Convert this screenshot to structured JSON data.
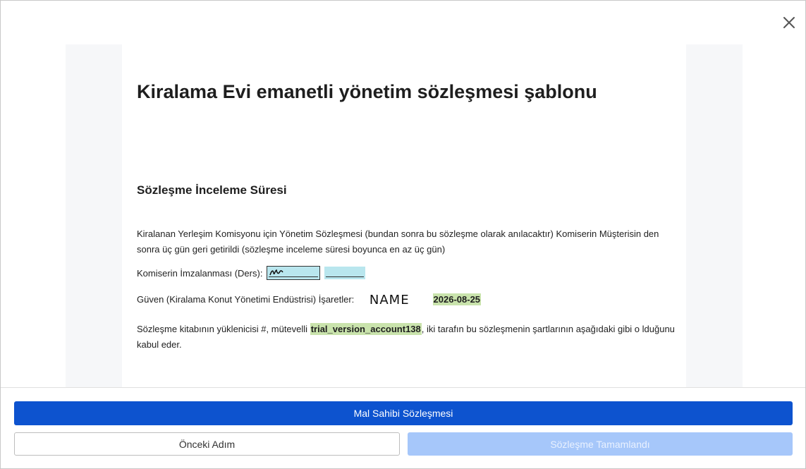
{
  "document": {
    "title": "Kiralama Evi emanetli yönetim sözleşmesi şablonu",
    "section_title": "Sözleşme İnceleme Süresi",
    "paragraph1": "Kiralanan Yerleşim Komisyonu için Yönetim Sözleşmesi (bundan sonra bu sözleşme olarak anılacaktır) Komiserin Müşterisin den sonra üç gün geri getirildi (sözleşme inceleme süresi boyunca en az üç gün)",
    "commissioner_sign_label": "Komiserin İmzalanması (Ders):",
    "trust_sign_label": "Güven (Kiralama Konut Yönetimi Endüstrisi) İşaretler:",
    "trust_signature_name": "NAME",
    "trust_sign_date": "2026-08-25",
    "paragraph3_prefix": "Sözleşme kitabının yüklenicisi #, mütevelli",
    "paragraph3_account": "trial_version_account138",
    "paragraph3_suffix": ", iki tarafın bu sözleşmenin şartlarının aşağıdaki gibi o lduğunu kabul eder."
  },
  "footer": {
    "primary_button": "Mal Sahibi Sözleşmesi",
    "previous_button": "Önceki Adım",
    "complete_button": "Sözleşme Tamamlandı"
  },
  "colors": {
    "primary": "#0d53cf",
    "disabled": "#a6c7fa",
    "signature_field": "#b9e6ee",
    "highlight": "#c9e3ac"
  },
  "icons": {
    "close": "close-icon"
  }
}
